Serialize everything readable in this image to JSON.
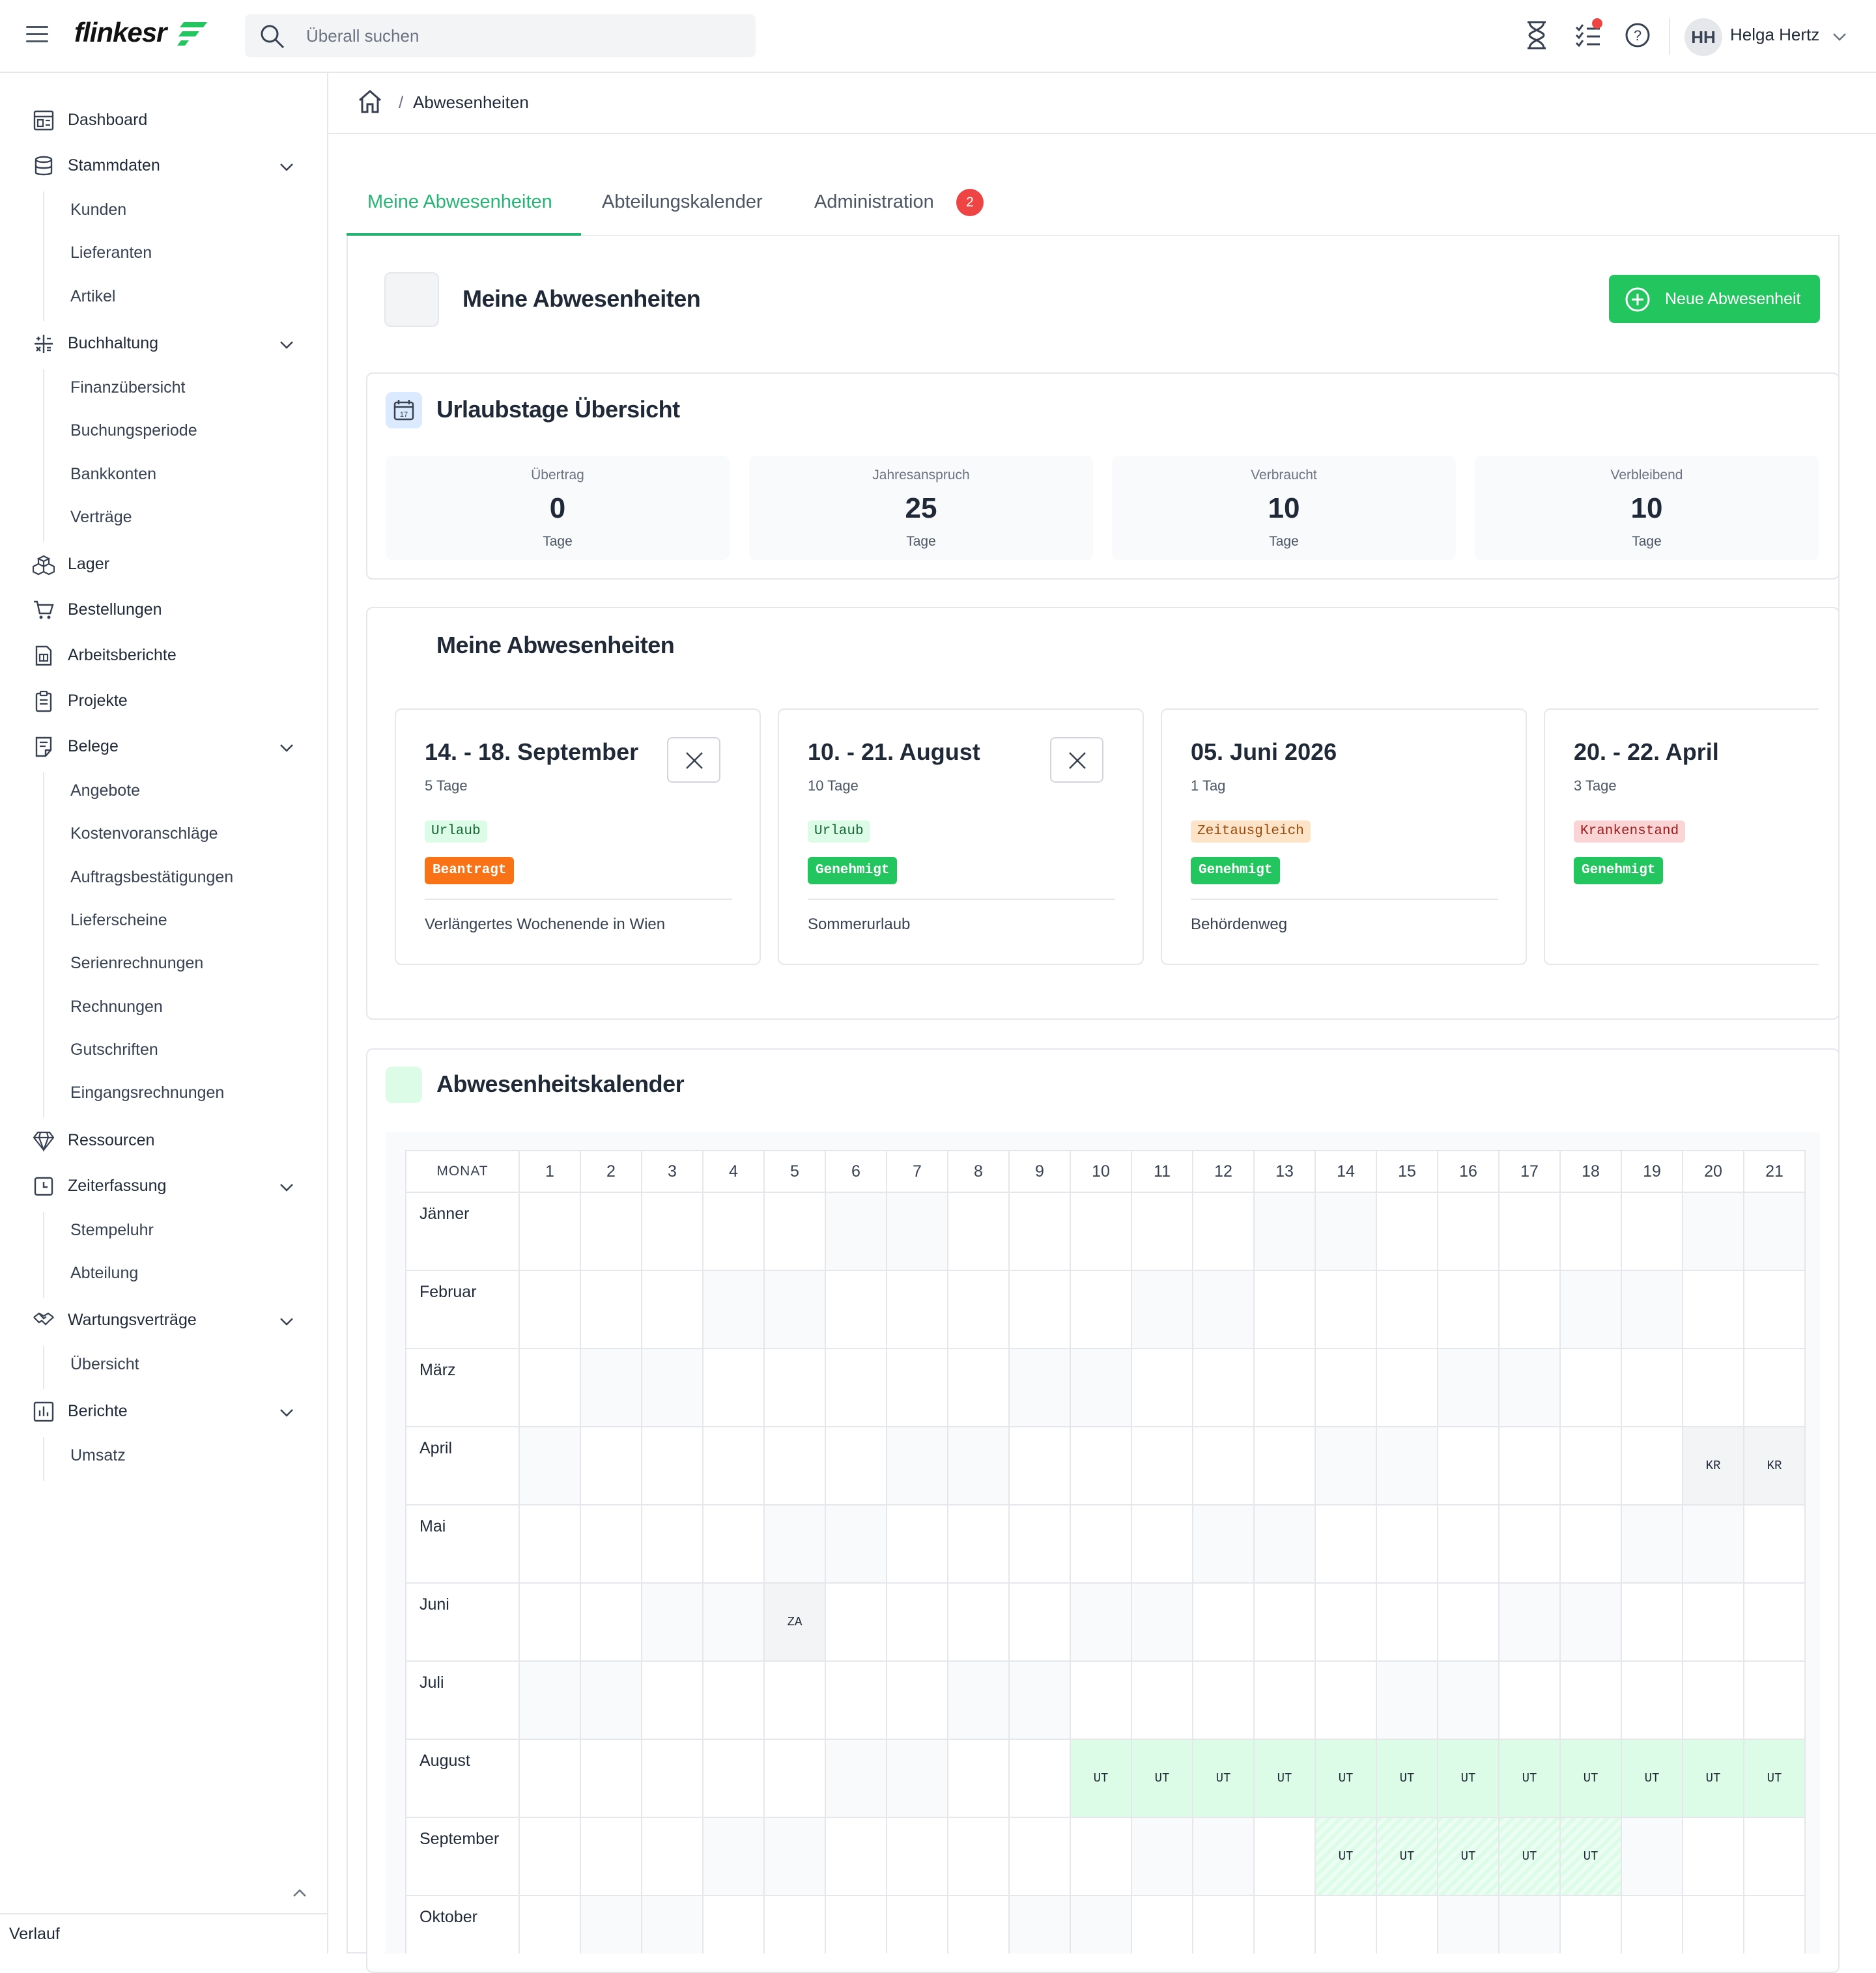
{
  "app": {
    "logo": "flinkesr"
  },
  "search": {
    "placeholder": "Überall suchen"
  },
  "user": {
    "initials": "HH",
    "name": "Helga Hertz"
  },
  "sidebar": {
    "items": [
      {
        "label": "Dashboard",
        "icon": "dashboard-icon"
      },
      {
        "label": "Stammdaten",
        "icon": "database-icon",
        "children": [
          "Kunden",
          "Lieferanten",
          "Artikel"
        ]
      },
      {
        "label": "Buchhaltung",
        "icon": "calculator-icon",
        "children": [
          "Finanzübersicht",
          "Buchungsperiode",
          "Bankkonten",
          "Verträge"
        ]
      },
      {
        "label": "Lager",
        "icon": "boxes-icon"
      },
      {
        "label": "Bestellungen",
        "icon": "cart-icon"
      },
      {
        "label": "Arbeitsberichte",
        "icon": "report-icon"
      },
      {
        "label": "Projekte",
        "icon": "clipboard-icon"
      },
      {
        "label": "Belege",
        "icon": "receipt-icon",
        "children": [
          "Angebote",
          "Kostenvoranschläge",
          "Auftragsbestätigungen",
          "Lieferscheine",
          "Serienrechnungen",
          "Rechnungen",
          "Gutschriften",
          "Eingangsrechnungen"
        ]
      },
      {
        "label": "Ressourcen",
        "icon": "diamond-icon"
      },
      {
        "label": "Zeiterfassung",
        "icon": "timer-icon",
        "children": [
          "Stempeluhr",
          "Abteilung"
        ]
      },
      {
        "label": "Wartungsverträge",
        "icon": "handshake-icon",
        "children": [
          "Übersicht"
        ]
      },
      {
        "label": "Berichte",
        "icon": "bar-chart-icon",
        "children": [
          "Umsatz"
        ]
      }
    ],
    "footer": "Verlauf"
  },
  "breadcrumb": {
    "separator": "/",
    "current": "Abwesenheiten"
  },
  "tabs": [
    {
      "label": "Meine Abwesenheiten",
      "active": true
    },
    {
      "label": "Abteilungskalender"
    },
    {
      "label": "Administration",
      "badge": "2"
    }
  ],
  "page": {
    "title": "Meine Abwesenheiten",
    "new_button": "Neue Abwesenheit"
  },
  "overview": {
    "title": "Urlaubstage Übersicht",
    "stats": [
      {
        "label": "Übertrag",
        "value": "0",
        "unit": "Tage"
      },
      {
        "label": "Jahresanspruch",
        "value": "25",
        "unit": "Tage"
      },
      {
        "label": "Verbraucht",
        "value": "10",
        "unit": "Tage"
      },
      {
        "label": "Verbleibend",
        "value": "10",
        "unit": "Tage"
      }
    ]
  },
  "absences": {
    "title": "Meine Abwesenheiten",
    "items": [
      {
        "date": "14. - 18. September",
        "days": "5 Tage",
        "type": "Urlaub",
        "status": "Beantragt",
        "note": "Verlängertes Wochenende in Wien",
        "cancel": true
      },
      {
        "date": "10. - 21. August",
        "days": "10 Tage",
        "type": "Urlaub",
        "status": "Genehmigt",
        "note": "Sommerurlaub",
        "cancel": true
      },
      {
        "date": "05. Juni 2026",
        "days": "1 Tag",
        "type": "Zeitausgleich",
        "status": "Genehmigt",
        "note": "Behördenweg",
        "cancel": false
      },
      {
        "date": "20. - 22. April",
        "days": "3 Tage",
        "type": "Krankenstand",
        "status": "Genehmigt",
        "note": "",
        "cancel": false
      }
    ],
    "colors": {
      "Urlaub": "#dcfce7",
      "Zeitausgleich": "#fde4c8",
      "Krankenstand": "#fbd5d5",
      "Beantragt": "#f97316",
      "Genehmigt": "#22c55e"
    }
  },
  "calendar": {
    "title": "Abwesenheitskalender",
    "month_header": "MONAT",
    "days": [
      "1",
      "2",
      "3",
      "4",
      "5",
      "6",
      "7",
      "8",
      "9",
      "10",
      "11",
      "12",
      "13",
      "14",
      "15",
      "16",
      "17",
      "18",
      "19",
      "20",
      "21"
    ],
    "months": [
      "Jänner",
      "Februar",
      "März",
      "April",
      "Mai",
      "Juni",
      "Juli",
      "August",
      "September",
      "Oktober"
    ],
    "entries": {
      "April": {
        "20": "KR",
        "21": "KR"
      },
      "Juni": {
        "5": "ZA"
      },
      "August": {
        "10": "UT",
        "11": "UT",
        "12": "UT",
        "13": "UT",
        "14": "UT",
        "15": "UT",
        "16": "UT",
        "17": "UT",
        "18": "UT",
        "19": "UT",
        "20": "UT",
        "21": "UT"
      },
      "September": {
        "14": "UT",
        "15": "UT",
        "16": "UT",
        "17": "UT",
        "18": "UT"
      }
    },
    "pending": {
      "September": [
        "14",
        "15",
        "16",
        "17",
        "18"
      ]
    }
  }
}
